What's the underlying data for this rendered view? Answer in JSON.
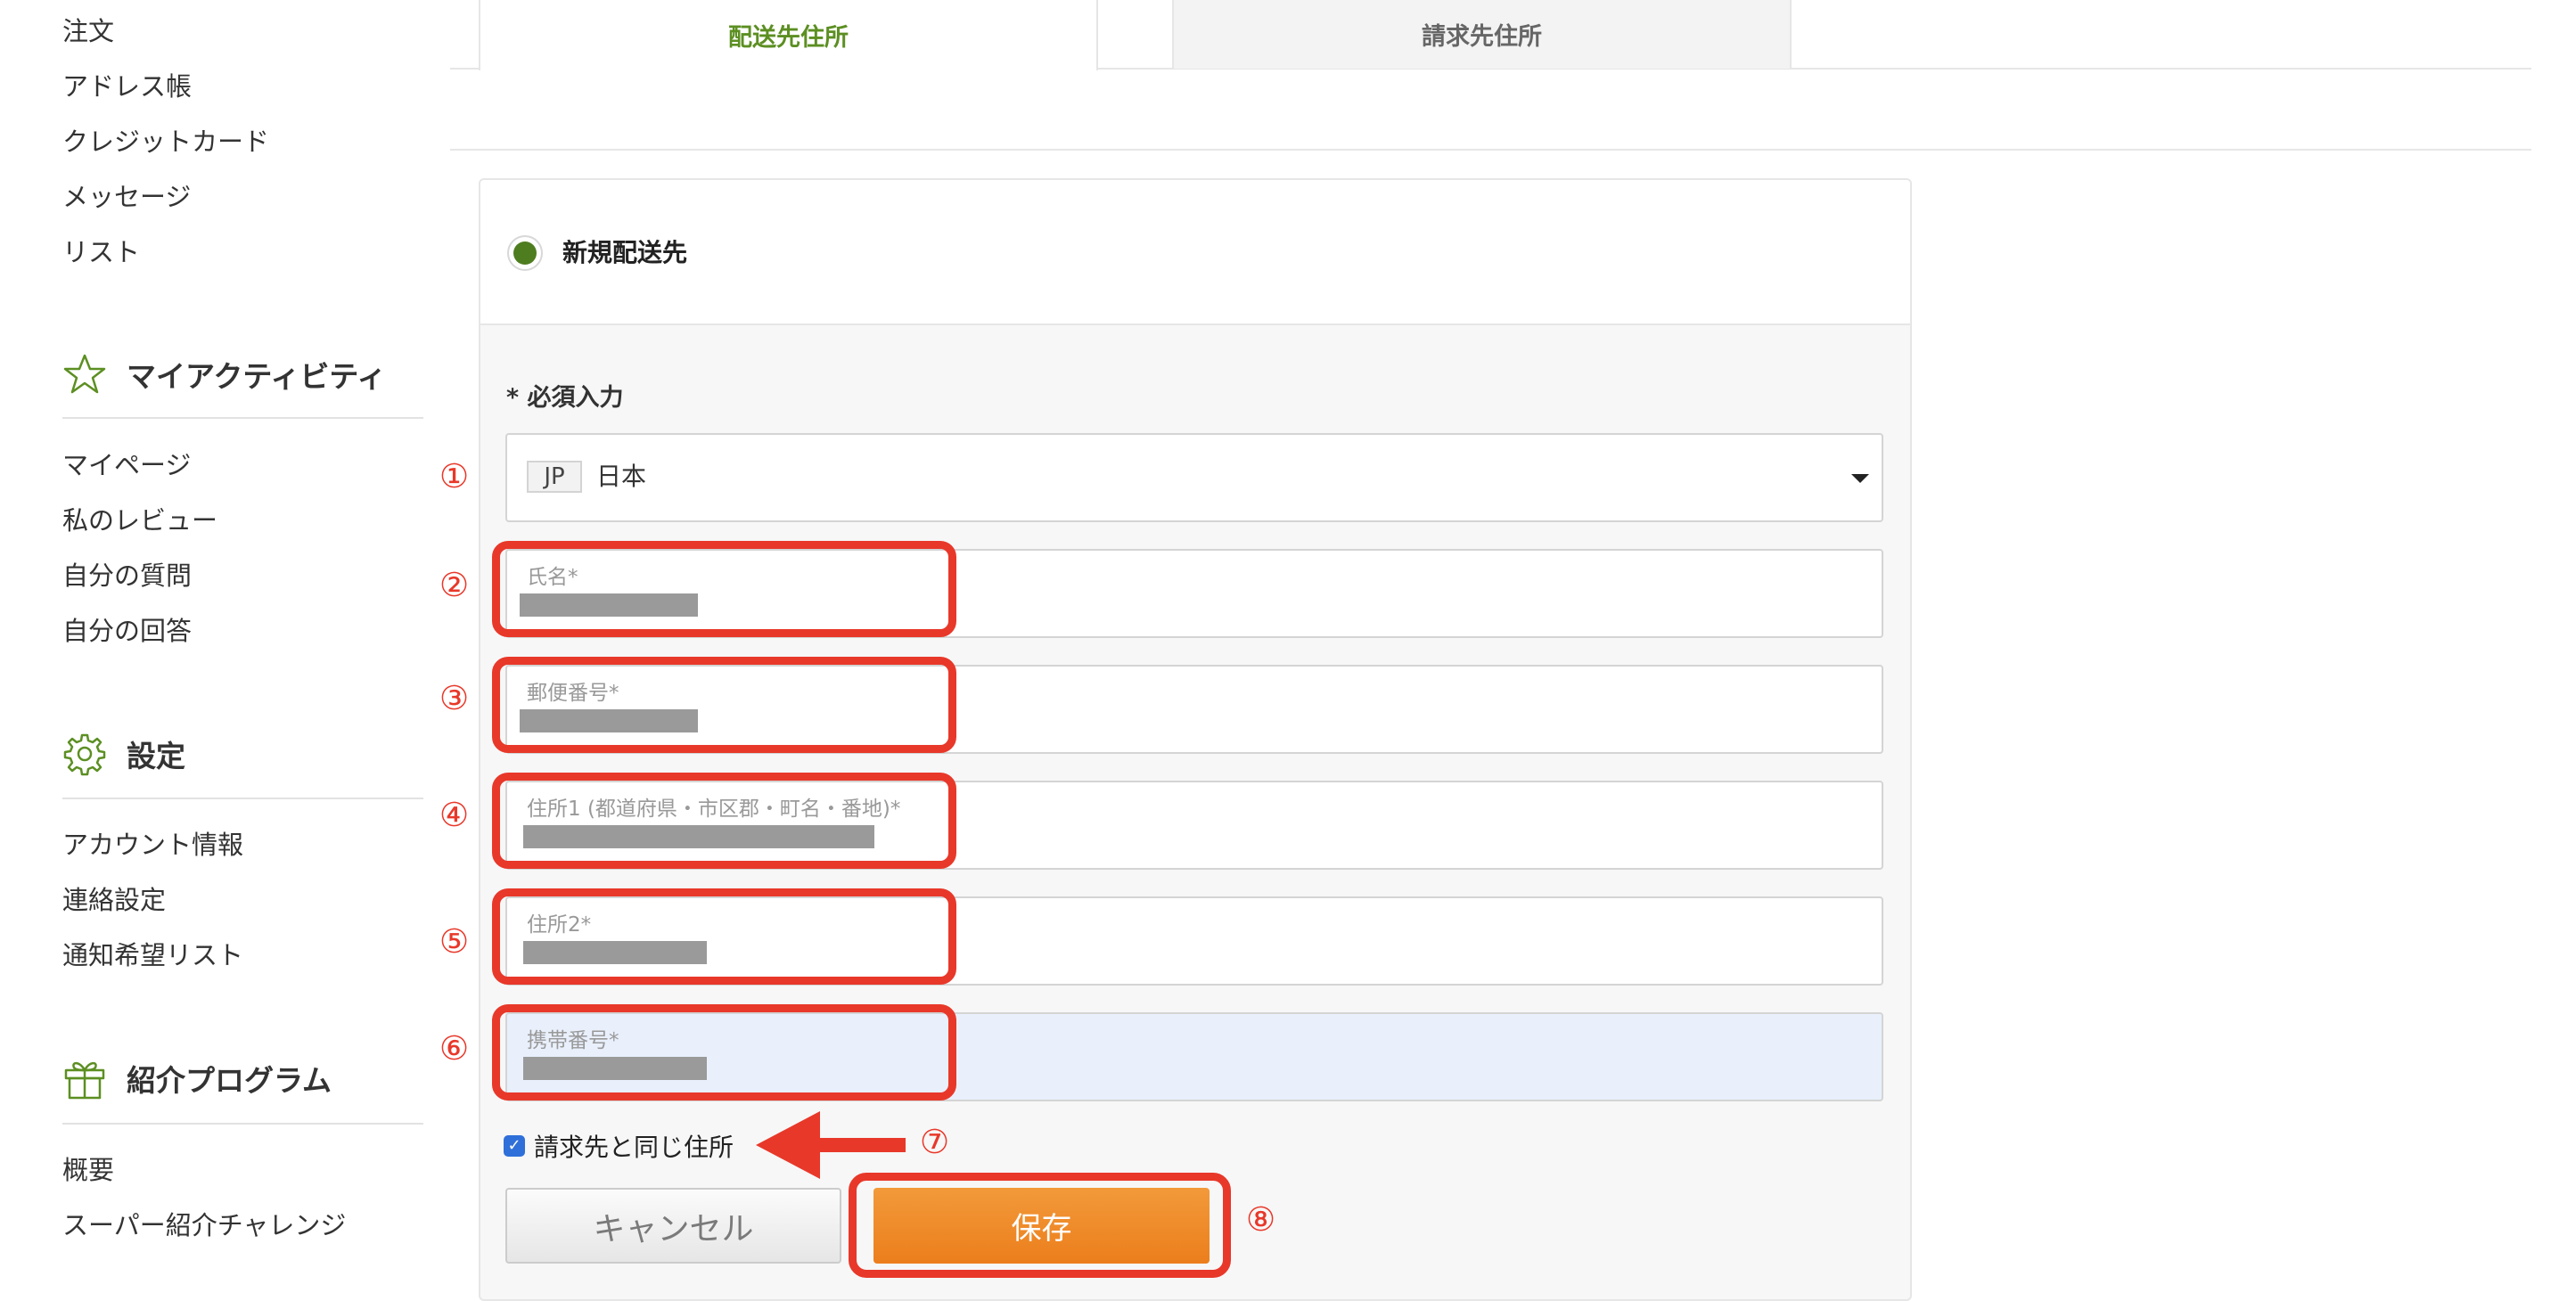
{
  "sidebar": {
    "top_links": [
      "注文",
      "アドレス帳",
      "クレジットカード",
      "メッセージ",
      "リスト"
    ],
    "sections": [
      {
        "icon": "star-icon",
        "title": "マイアクティビティ",
        "links": [
          "マイページ",
          "私のレビュー",
          "自分の質問",
          "自分の回答"
        ]
      },
      {
        "icon": "gear-icon",
        "title": "設定",
        "links": [
          "アカウント情報",
          "連絡設定",
          "通知希望リスト"
        ]
      },
      {
        "icon": "gift-icon",
        "title": "紹介プログラム",
        "links": [
          "概要",
          "スーパー紹介チャレンジ"
        ]
      }
    ]
  },
  "tabs": [
    {
      "label": "配送先住所",
      "active": true
    },
    {
      "label": "請求先住所",
      "active": false
    }
  ],
  "form": {
    "option_label": "新規配送先",
    "option_selected": true,
    "required_note": "* 必須入力",
    "country": {
      "code": "JP",
      "name": "日本"
    },
    "fields": [
      {
        "label": "氏名*"
      },
      {
        "label": "郵便番号*"
      },
      {
        "label": "住所1 (都道府県・市区郡・町名・番地)*"
      },
      {
        "label": "住所2*"
      },
      {
        "label": "携帯番号*"
      }
    ],
    "same_as_billing_label": "請求先と同じ住所",
    "same_as_billing_checked": true,
    "cancel_label": "キャンセル",
    "save_label": "保存"
  },
  "annotations": {
    "numbers": [
      "①",
      "②",
      "③",
      "④",
      "⑤",
      "⑥",
      "⑦",
      "⑧"
    ],
    "color": "#e8382a"
  },
  "colors": {
    "accent_green": "#5c8f22",
    "save_orange": "#ec7e1c",
    "checkbox_blue": "#2f6fd9"
  }
}
